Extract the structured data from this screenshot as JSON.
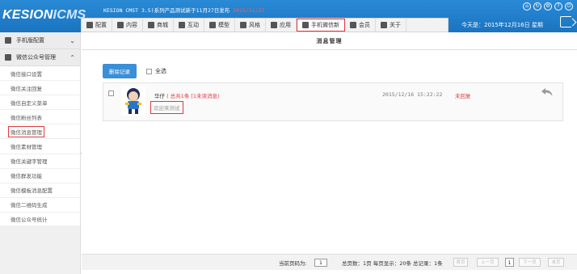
{
  "header": {
    "logo_main": "KESION",
    "logo_accent": "ICMS",
    "notice": "KESION CMST 3.5)系列产品测试新于11月27日发布",
    "notice_date": "2015/11/27",
    "greeting": "今天是：2015年12月16日 星期",
    "window_icons": [
      "home-icon",
      "refresh-icon",
      "settings-icon",
      "help-icon",
      "power-icon"
    ]
  },
  "topmenu": {
    "items": [
      {
        "label": "配置",
        "icon": "gear-icon"
      },
      {
        "label": "内容",
        "icon": "document-icon"
      },
      {
        "label": "商城",
        "icon": "shop-icon"
      },
      {
        "label": "互动",
        "icon": "users-icon"
      },
      {
        "label": "模型",
        "icon": "grid-icon"
      },
      {
        "label": "风格",
        "icon": "tag-icon"
      },
      {
        "label": "应用",
        "icon": "monitor-icon"
      },
      {
        "label": "手机微信新",
        "icon": "list-icon",
        "active": true
      },
      {
        "label": "会员",
        "icon": "user-icon"
      },
      {
        "label": "关于",
        "icon": "menu-icon"
      }
    ]
  },
  "sidebar": {
    "group1": {
      "label": "手机版配置",
      "icon": "gear-icon"
    },
    "group2": {
      "label": "微信公众号管理",
      "icon": "chat-icon"
    },
    "items": [
      {
        "label": "微信接口设置"
      },
      {
        "label": "微信关注回复"
      },
      {
        "label": "微信自定义菜单"
      },
      {
        "label": "微信粉丝列表"
      },
      {
        "label": "微信消息管理",
        "active": true
      },
      {
        "label": "微信素材管理"
      },
      {
        "label": "微信关键字管理"
      },
      {
        "label": "微信群发功能"
      },
      {
        "label": "微信模板消息配置"
      },
      {
        "label": "微信二维码生成"
      },
      {
        "label": "微信公众号统计"
      }
    ]
  },
  "main": {
    "title": "消息管理",
    "delete_button": "删除记录",
    "select_all": "全选",
    "message": {
      "sender": "华仔",
      "count_text": "( 总共1条 [1未读消息)",
      "text": "欢迎来测试",
      "time": "2015/12/16 15:22:22",
      "status": "未回复"
    },
    "pager": {
      "current_label": "当前页码为:",
      "current_page": "1",
      "stats": "总页数：1页 每页显示：20条 总记录：1条",
      "first": "首页",
      "prev": "上一页",
      "page": "1",
      "next": "下一页",
      "last": "末页"
    }
  },
  "colors": {
    "header_blue": "#1a74c0",
    "accent_red": "#e0393e",
    "button_blue": "#3b8fd8"
  }
}
